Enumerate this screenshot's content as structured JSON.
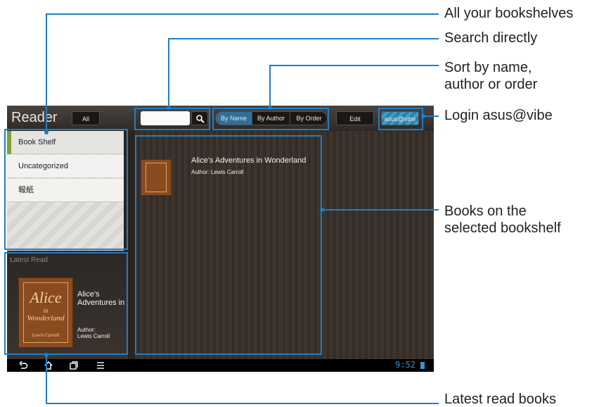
{
  "app": {
    "title": "Reader"
  },
  "toolbar": {
    "all_label": "All",
    "sort_by_name": "By Name",
    "sort_by_author": "By Author",
    "sort_by_order": "By Order",
    "edit_label": "Edit",
    "login_label": "asus@vibe",
    "search_placeholder": ""
  },
  "shelves": {
    "items": [
      {
        "label": "Book Shelf",
        "selected": true
      },
      {
        "label": "Uncategorized",
        "selected": false
      },
      {
        "label": "報紙",
        "selected": false
      }
    ]
  },
  "latest": {
    "section_label": "Latest Read",
    "title": "Alice's Adventures in",
    "author_label": "Author:",
    "author": "Lewis Carroll",
    "cover_title": "Alice",
    "cover_sub": "in",
    "cover_sub2": "Wonderland",
    "cover_author": "Lewis Carroll"
  },
  "books": [
    {
      "title": "Alice's Adventures in Wonderland",
      "author": "Author: Lewis Carroll"
    }
  ],
  "status_bar": {
    "clock": "9:52"
  },
  "callouts": {
    "bookshelves": "All your bookshelves",
    "search": "Search directly",
    "sort_line1": "Sort by name,",
    "sort_line2": "author or order",
    "login": "Login asus@vibe",
    "books_line1": "Books on the",
    "books_line2": "selected bookshelf",
    "latest": "Latest read books"
  },
  "colors": {
    "callout_line": "#1e7ec8",
    "accent": "#7da23b"
  }
}
